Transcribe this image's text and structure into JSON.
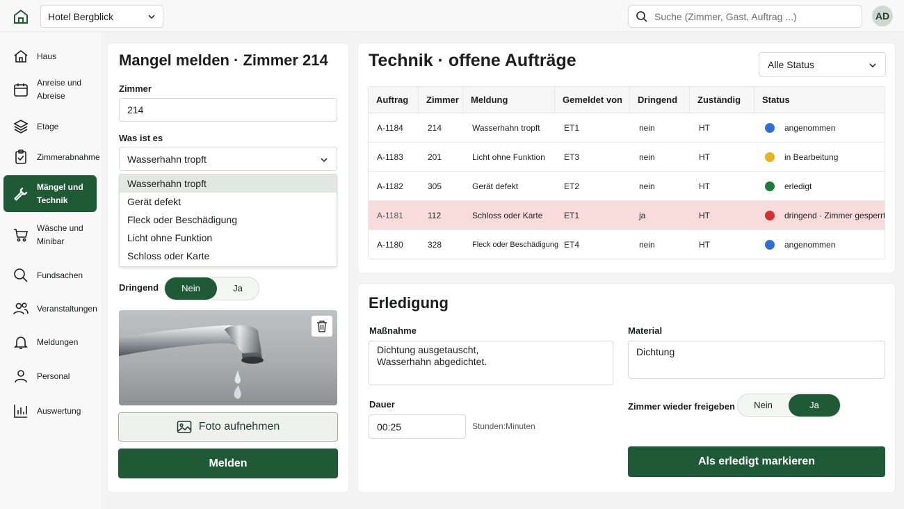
{
  "topbar": {
    "hotel": "Hotel Bergblick",
    "search_placeholder": "Suche (Zimmer, Gast, Auftrag ...)",
    "avatar": "AD"
  },
  "sidebar": {
    "items": [
      {
        "label": "Haus"
      },
      {
        "label": "Anreise und Abreise"
      },
      {
        "label": "Etage"
      },
      {
        "label": "Zimmerabnahme"
      },
      {
        "label": "Mängel und Technik"
      },
      {
        "label": "Wäsche und Minibar"
      },
      {
        "label": "Fundsachen"
      },
      {
        "label": "Veranstaltungen"
      },
      {
        "label": "Meldungen"
      },
      {
        "label": "Personal"
      },
      {
        "label": "Auswertung"
      }
    ]
  },
  "report": {
    "title": "Mangel melden · Zimmer 214",
    "room_label": "Zimmer",
    "room_value": "214",
    "what_label": "Was ist es",
    "what_value": "Wasserhahn tropft",
    "options": [
      "Wasserhahn tropft",
      "Gerät defekt",
      "Fleck oder Beschädigung",
      "Licht ohne Funktion",
      "Schloss oder Karte"
    ],
    "urgent_label": "Dringend",
    "urgent_no": "Nein",
    "urgent_yes": "Ja",
    "photo_button": "Foto aufnehmen",
    "submit_button": "Melden"
  },
  "orders": {
    "title": "Technik · offene Aufträge",
    "filter": "Alle Status",
    "columns": [
      "Auftrag",
      "Zimmer",
      "Meldung",
      "Gemeldet von",
      "Dringend",
      "Zuständig",
      "Status"
    ],
    "rows": [
      {
        "id": "A-1184",
        "room": "214",
        "message": "Wasserhahn tropft",
        "by": "ET1",
        "urgent": "nein",
        "assignee": "HT",
        "status": "angenommen",
        "status_color": "#2f6fd6"
      },
      {
        "id": "A-1183",
        "room": "201",
        "message": "Licht ohne Funktion",
        "by": "ET3",
        "urgent": "nein",
        "assignee": "HT",
        "status": "in Bearbeitung",
        "status_color": "#e8b21e"
      },
      {
        "id": "A-1182",
        "room": "305",
        "message": "Gerät defekt",
        "by": "ET2",
        "urgent": "nein",
        "assignee": "HT",
        "status": "erledigt",
        "status_color": "#1f7a3d"
      },
      {
        "id": "A-1181",
        "room": "112",
        "message": "Schloss oder Karte",
        "by": "ET1",
        "urgent": "ja",
        "assignee": "HT",
        "status": "dringend · Zimmer gesperrt",
        "status_color": "#d62f2f"
      },
      {
        "id": "A-1180",
        "room": "328",
        "message": "Fleck oder Beschädigung",
        "by": "ET4",
        "urgent": "nein",
        "assignee": "HT",
        "status": "angenommen",
        "status_color": "#2f6fd6"
      }
    ]
  },
  "completion": {
    "title": "Erledigung",
    "measure_label": "Maßnahme",
    "measure_value": "Dichtung ausgetauscht,\nWasserhahn abgedichtet.",
    "material_label": "Material",
    "material_value": "Dichtung",
    "duration_label": "Dauer",
    "duration_value": "00:25",
    "duration_hint": "Stunden:Minuten",
    "release_label": "Zimmer wieder freigeben",
    "release_no": "Nein",
    "release_yes": "Ja",
    "done_button": "Als erledigt markieren"
  }
}
